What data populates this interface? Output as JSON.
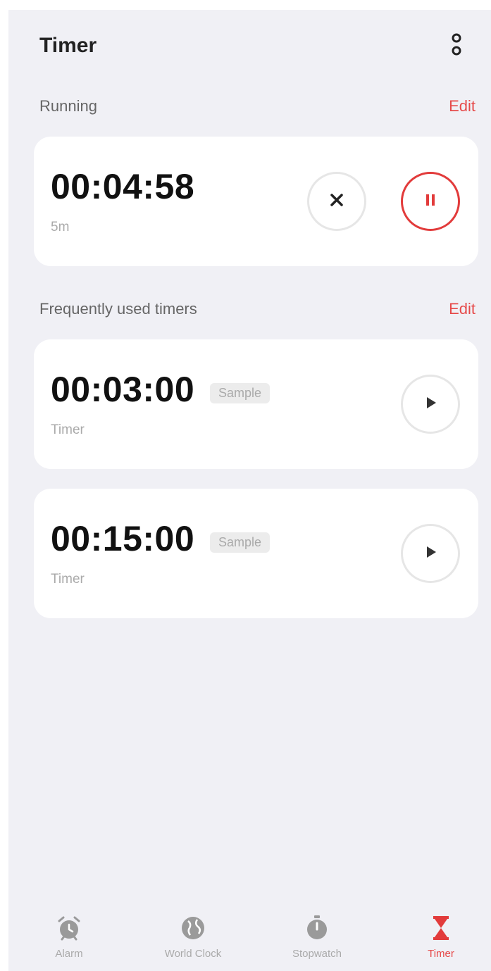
{
  "header": {
    "title": "Timer",
    "more_icon": "more-vertical-icon"
  },
  "running": {
    "label": "Running",
    "action": "Edit",
    "timer": {
      "time": "00:04:58",
      "subtitle": "5m"
    }
  },
  "frequent": {
    "label": "Frequently used timers",
    "action": "Edit",
    "timers": [
      {
        "time": "00:03:00",
        "badge": "Sample",
        "subtitle": "Timer"
      },
      {
        "time": "00:15:00",
        "badge": "Sample",
        "subtitle": "Timer"
      }
    ]
  },
  "tabs": [
    {
      "label": "Alarm",
      "icon": "alarm-clock-icon"
    },
    {
      "label": "World Clock",
      "icon": "globe-icon"
    },
    {
      "label": "Stopwatch",
      "icon": "stopwatch-icon"
    },
    {
      "label": "Timer",
      "icon": "hourglass-icon",
      "active": true
    }
  ],
  "colors": {
    "accent": "#e23b3b",
    "background": "#f0f0f5",
    "card": "#ffffff"
  }
}
